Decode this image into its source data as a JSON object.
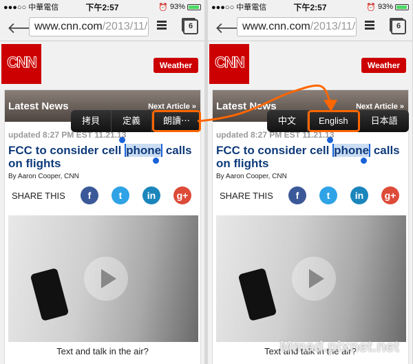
{
  "status": {
    "carrier": "●●●○○ 中華電信",
    "time": "下午2:57",
    "battery": "93%",
    "battery_level": 0.93
  },
  "toolbar": {
    "url_host": "www.cnn.com",
    "url_path": "/2013/11/",
    "tab_count": "6"
  },
  "site": {
    "logo": "CNN",
    "weather": "Weather",
    "latest": "Latest News",
    "next": "Next Article »",
    "updated": "updated 8:27 PM EST 11.21.13",
    "headline_pre": "FCC to consider cell ",
    "headline_sel": "phone",
    "headline_post": " calls on flights",
    "byline": "By Aaron Cooper, CNN",
    "share": "SHARE THIS",
    "caption": "Text and talk in the air?"
  },
  "social": [
    {
      "icon": "facebook-icon",
      "glyph": "f",
      "color": "#3b5998"
    },
    {
      "icon": "twitter-icon",
      "glyph": "t",
      "color": "#2fa3e6"
    },
    {
      "icon": "linkedin-icon",
      "glyph": "in",
      "color": "#1b86bc"
    },
    {
      "icon": "google-plus-icon",
      "glyph": "g+",
      "color": "#dd4b39"
    }
  ],
  "left_popup": [
    "拷貝",
    "定義",
    "朗讀⋯"
  ],
  "right_popup": [
    "中文",
    "English",
    "日本語"
  ],
  "highlight_color": "#ff6600",
  "watermark": "Mmad.pixnet.net"
}
